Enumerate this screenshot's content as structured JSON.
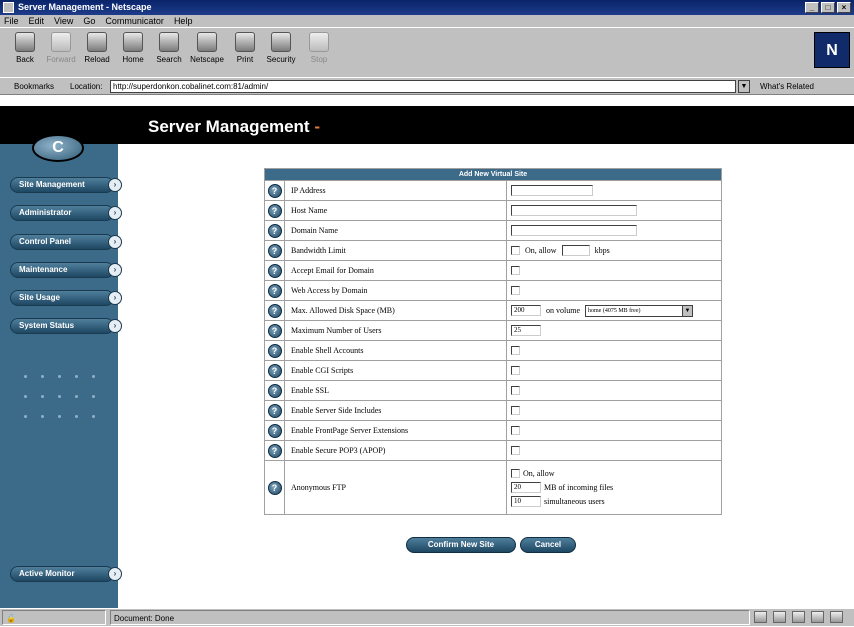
{
  "window": {
    "title": "Server Management - Netscape"
  },
  "menu": [
    "File",
    "Edit",
    "View",
    "Go",
    "Communicator",
    "Help"
  ],
  "toolbar": {
    "buttons": [
      {
        "label": "Back",
        "icon": "back-icon",
        "enabled": true
      },
      {
        "label": "Forward",
        "icon": "forward-icon",
        "enabled": false
      },
      {
        "label": "Reload",
        "icon": "reload-icon",
        "enabled": true
      },
      {
        "label": "Home",
        "icon": "home-icon",
        "enabled": true
      },
      {
        "label": "Search",
        "icon": "search-icon",
        "enabled": true
      },
      {
        "label": "Netscape",
        "icon": "netscape-icon",
        "enabled": true
      },
      {
        "label": "Print",
        "icon": "print-icon",
        "enabled": true
      },
      {
        "label": "Security",
        "icon": "security-icon",
        "enabled": true
      },
      {
        "label": "Stop",
        "icon": "stop-icon",
        "enabled": false
      }
    ],
    "logo": "N"
  },
  "location": {
    "bookmarks_label": "Bookmarks",
    "label": "Location:",
    "url": "http://superdonkon.cobalinet.com:81/admin/",
    "related_label": "What's Related"
  },
  "page": {
    "title": "Server Management",
    "title_suffix": "-",
    "logo_letter": "C"
  },
  "sidebar": {
    "items": [
      {
        "label": "Site Management"
      },
      {
        "label": "Administrator"
      },
      {
        "label": "Control Panel"
      },
      {
        "label": "Maintenance"
      },
      {
        "label": "Site Usage"
      },
      {
        "label": "System Status"
      }
    ],
    "bottom_item": {
      "label": "Active Monitor"
    }
  },
  "form": {
    "caption": "Add New Virtual Site",
    "rows": [
      {
        "label": "IP Address",
        "type": "text",
        "value": ""
      },
      {
        "label": "Host Name",
        "type": "text",
        "value": ""
      },
      {
        "label": "Domain Name",
        "type": "text",
        "value": ""
      },
      {
        "label": "Bandwidth Limit",
        "type": "bandwidth",
        "checkbox_label": "On, allow",
        "value": "",
        "unit": "kbps"
      },
      {
        "label": "Accept Email for Domain",
        "type": "checkbox"
      },
      {
        "label": "Web Access by Domain",
        "type": "checkbox"
      },
      {
        "label": "Max. Allowed Disk Space (MB)",
        "type": "disk",
        "value": "200",
        "volume_label": "on volume",
        "volume_option": "home (4075 MB free)"
      },
      {
        "label": "Maximum Number of Users",
        "type": "text",
        "value": "25"
      },
      {
        "label": "Enable Shell Accounts",
        "type": "checkbox"
      },
      {
        "label": "Enable CGI Scripts",
        "type": "checkbox"
      },
      {
        "label": "Enable SSL",
        "type": "checkbox"
      },
      {
        "label": "Enable Server Side Includes",
        "type": "checkbox"
      },
      {
        "label": "Enable FrontPage Server Extensions",
        "type": "checkbox"
      },
      {
        "label": "Enable Secure POP3 (APOP)",
        "type": "checkbox"
      }
    ],
    "ftp": {
      "label": "Anonymous FTP",
      "checkbox_label": "On, allow",
      "space_value": "20",
      "space_label": "MB of incoming files",
      "users_value": "10",
      "users_label": "simultaneous users"
    },
    "confirm_label": "Confirm New Site",
    "cancel_label": "Cancel"
  },
  "status": {
    "security": "",
    "text": "Document: Done"
  }
}
